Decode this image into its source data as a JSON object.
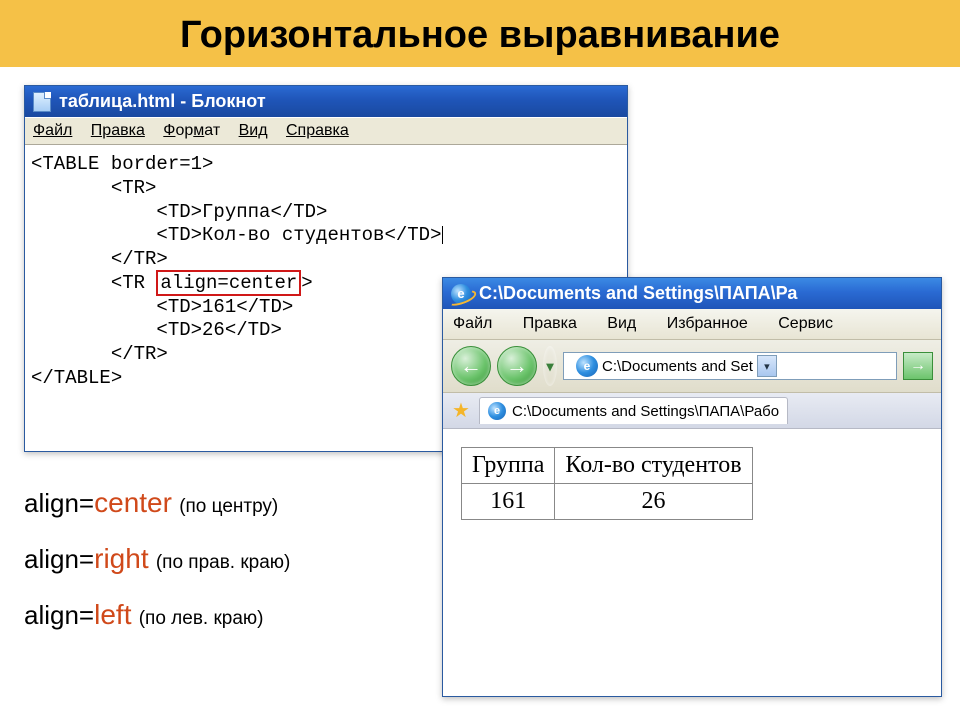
{
  "slide": {
    "title": "Горизонтальное выравнивание"
  },
  "notepad": {
    "title": "таблица.html - Блокнот",
    "menu": {
      "file": "Файл",
      "edit": "Правка",
      "format": "Формат",
      "view": "Вид",
      "help": "Справка"
    },
    "code": {
      "l1": "<TABLE border=1>",
      "l2": "       <TR>",
      "l3": "           <TD>Группа</TD>",
      "l4": "           <TD>Кол-во студентов</TD>",
      "l5": "       </TR>",
      "l6a": "       <TR ",
      "l6b": "align=center",
      "l6c": ">",
      "l7": "           <TD>161</TD>",
      "l8": "           <TD>26</TD>",
      "l9": "       </TR>",
      "l10": "</TABLE>"
    }
  },
  "ie": {
    "title": "C:\\Documents and Settings\\ПАПА\\Ра",
    "menu": {
      "file": "Файл",
      "edit": "Правка",
      "view": "Вид",
      "fav": "Избранное",
      "tools": "Сервис"
    },
    "address_short": "C:\\Documents and Set",
    "tab_text": "C:\\Documents and Settings\\ПАПА\\Рабо",
    "table": {
      "h1": "Группа",
      "h2": "Кол-во студентов",
      "d1": "161",
      "d2": "26"
    }
  },
  "legend": {
    "items": [
      {
        "attr": "align=",
        "value": "center",
        "note": "(по центру)"
      },
      {
        "attr": "align=",
        "value": "right",
        "note": "(по прав. краю)"
      },
      {
        "attr": "align=",
        "value": "left",
        "note": "(по лев. краю)"
      }
    ]
  }
}
